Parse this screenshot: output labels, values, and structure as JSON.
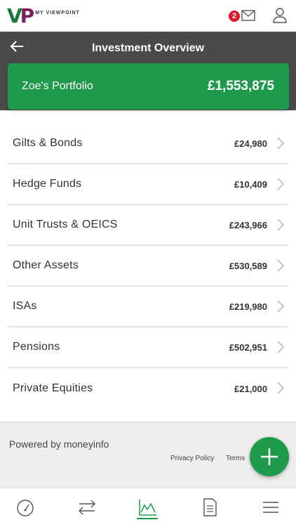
{
  "header": {
    "logo_text": "MY VIEWPOINT",
    "logo_letters": [
      "V",
      "P"
    ],
    "message_count": "2"
  },
  "titlebar": {
    "title": "Investment Overview"
  },
  "portfolio": {
    "name": "Zoe's Portfolio",
    "total": "£1,553,875"
  },
  "assets": [
    {
      "name": "Gilts & Bonds",
      "value": "£24,980"
    },
    {
      "name": "Hedge Funds",
      "value": "£10,409"
    },
    {
      "name": "Unit Trusts & OEICS",
      "value": "£243,966"
    },
    {
      "name": "Other Assets",
      "value": "£530,589"
    },
    {
      "name": "ISAs",
      "value": "£219,980"
    },
    {
      "name": "Pensions",
      "value": "£502,951"
    },
    {
      "name": "Private Equities",
      "value": "£21,000"
    }
  ],
  "footer": {
    "powered_by": "Powered by moneyinfo",
    "privacy": "Privacy Policy",
    "terms": "Terms"
  },
  "nav": {
    "items": [
      "dashboard-icon",
      "transfer-icon",
      "chart-icon",
      "document-icon",
      "menu-icon"
    ],
    "active": "chart-icon"
  },
  "colors": {
    "brand_green": "#1e9a4a",
    "brand_purple": "#7a1f5c",
    "titlebar_bg": "#4a4a4a",
    "badge_red": "#e0142b"
  }
}
